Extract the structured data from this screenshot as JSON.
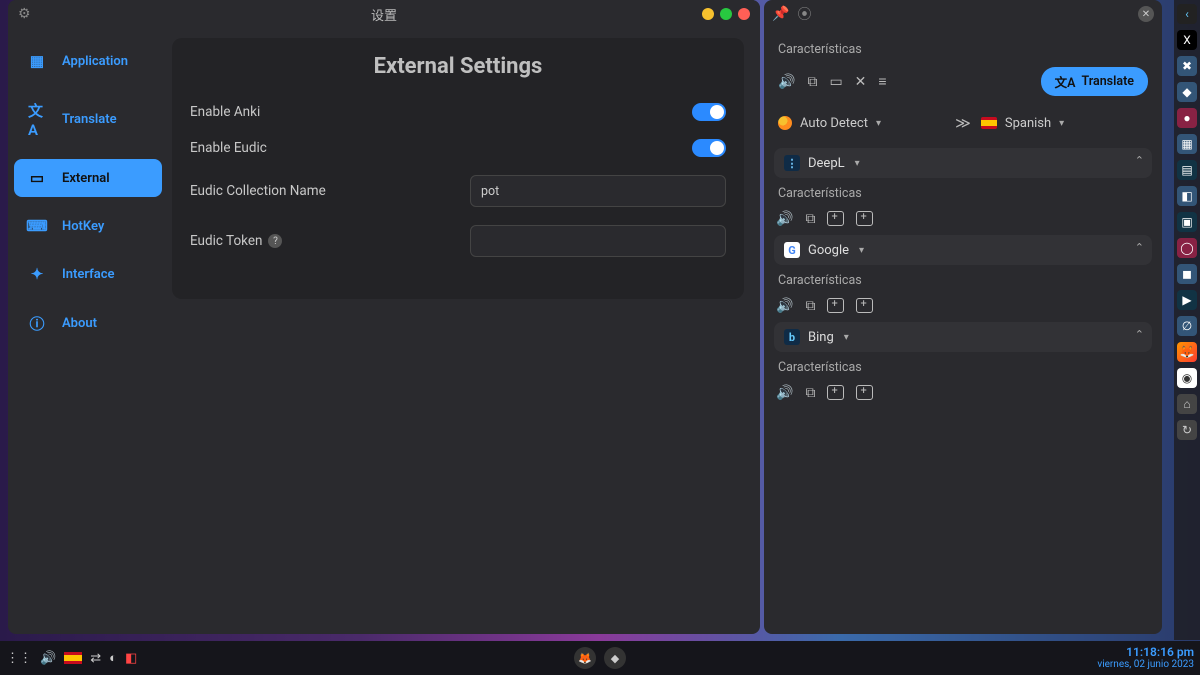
{
  "settings": {
    "window_title": "设置",
    "header": "External Settings",
    "sidebar": {
      "items": [
        {
          "label": "Application"
        },
        {
          "label": "Translate"
        },
        {
          "label": "External"
        },
        {
          "label": "HotKey"
        },
        {
          "label": "Interface"
        },
        {
          "label": "About"
        }
      ]
    },
    "fields": {
      "enable_anki": "Enable Anki",
      "enable_eudic": "Enable Eudic",
      "eudic_collection_label": "Eudic Collection Name",
      "eudic_collection_value": "pot",
      "eudic_token_label": "Eudic Token"
    }
  },
  "translate": {
    "source_label": "Características",
    "translate_button": "Translate",
    "source_lang": "Auto Detect",
    "target_lang": "Spanish",
    "services": [
      {
        "name": "DeepL",
        "result": "Características"
      },
      {
        "name": "Google",
        "result": "Características"
      },
      {
        "name": "Bing",
        "result": "Características"
      }
    ]
  },
  "taskbar": {
    "time": "11:18:16 pm",
    "date": "viernes, 02 junio 2023"
  }
}
